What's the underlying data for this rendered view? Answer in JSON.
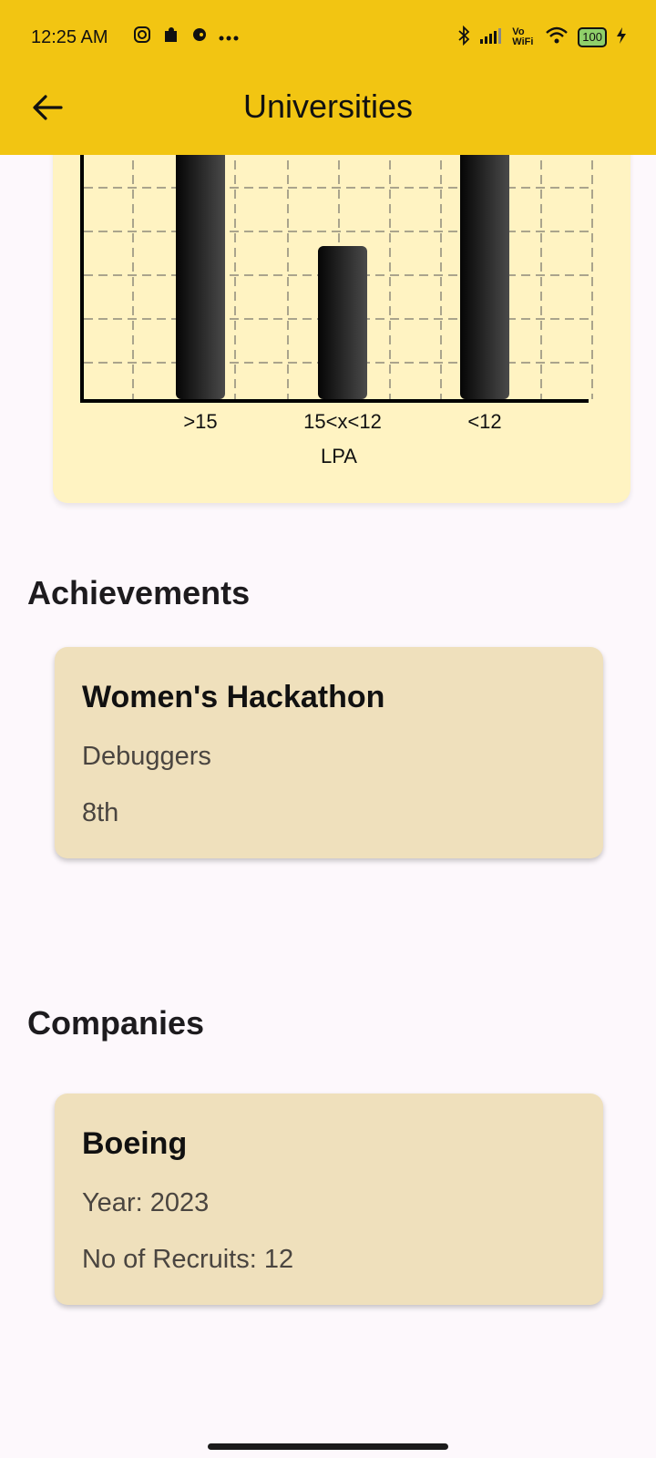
{
  "status_bar": {
    "time": "12:25 AM",
    "vo_wifi": "Vo WiFi",
    "battery": "100",
    "icons_left": [
      "instagram-icon",
      "puzzle-icon",
      "app-icon",
      "more-icon"
    ],
    "icons_right": [
      "bluetooth-icon",
      "signal-icon",
      "wifi-icon",
      "battery-icon",
      "charging-icon"
    ]
  },
  "app_bar": {
    "title": "Universities"
  },
  "chart_data": {
    "type": "bar",
    "categories": [
      ">15",
      "15<x<12",
      "<12"
    ],
    "values": [
      null,
      3.5,
      null
    ],
    "xlabel": "LPA",
    "grid": true,
    "note_values": "bars for >15 and <12 extend beyond visible top edge"
  },
  "achievements": {
    "heading": "Achievements",
    "items": [
      {
        "title": "Women's Hackathon",
        "team": "Debuggers",
        "rank": "8th"
      }
    ]
  },
  "companies": {
    "heading": "Companies",
    "items": [
      {
        "name": "Boeing",
        "year": "Year: 2023",
        "recruits": "No of Recruits: 12"
      }
    ]
  },
  "colors": {
    "app_bar": "#f2c512",
    "chart_bg": "#fff3c2",
    "card_bg": "#efe0bc",
    "page_bg": "#fdf8fc"
  }
}
